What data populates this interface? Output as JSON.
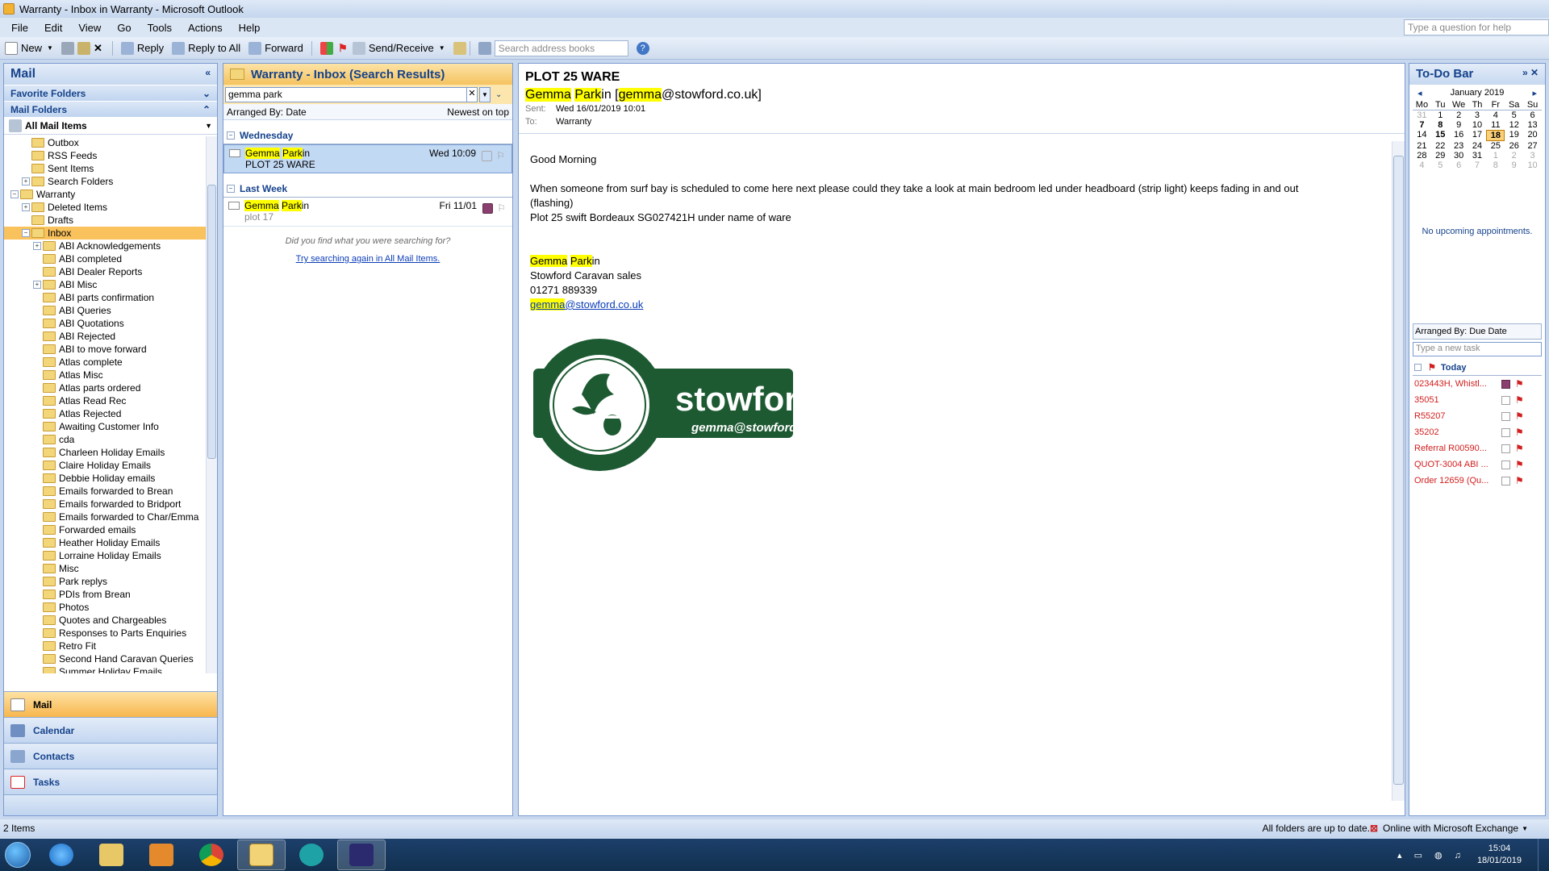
{
  "window": {
    "title": "Warranty - Inbox in Warranty - Microsoft Outlook"
  },
  "menu": {
    "items": [
      "File",
      "Edit",
      "View",
      "Go",
      "Tools",
      "Actions",
      "Help"
    ],
    "help_placeholder": "Type a question for help"
  },
  "toolbar": {
    "new_label": "New",
    "reply_label": "Reply",
    "reply_all_label": "Reply to All",
    "forward_label": "Forward",
    "send_receive_label": "Send/Receive",
    "address_placeholder": "Search address books"
  },
  "nav": {
    "title": "Mail",
    "favorite_folders": "Favorite Folders",
    "mail_folders": "Mail Folders",
    "all_mail_items": "All Mail Items",
    "folders": [
      {
        "label": "Outbox",
        "level": 2,
        "exp": ""
      },
      {
        "label": "RSS Feeds",
        "level": 2,
        "exp": ""
      },
      {
        "label": "Sent Items",
        "level": 2,
        "exp": ""
      },
      {
        "label": "Search Folders",
        "level": 2,
        "exp": "+"
      },
      {
        "label": "Warranty",
        "level": 1,
        "exp": "-"
      },
      {
        "label": "Deleted Items",
        "level": 2,
        "exp": "+"
      },
      {
        "label": "Drafts",
        "level": 2,
        "exp": ""
      },
      {
        "label": "Inbox",
        "level": 2,
        "exp": "-",
        "selected": true
      },
      {
        "label": "ABI Acknowledgements",
        "level": 3,
        "exp": "+"
      },
      {
        "label": "ABI completed",
        "level": 3,
        "exp": ""
      },
      {
        "label": "ABI Dealer Reports",
        "level": 3,
        "exp": ""
      },
      {
        "label": "ABI Misc",
        "level": 3,
        "exp": "+"
      },
      {
        "label": "ABI parts confirmation",
        "level": 3,
        "exp": ""
      },
      {
        "label": "ABI Queries",
        "level": 3,
        "exp": ""
      },
      {
        "label": "ABI Quotations",
        "level": 3,
        "exp": ""
      },
      {
        "label": "ABI Rejected",
        "level": 3,
        "exp": ""
      },
      {
        "label": "ABI to move forward",
        "level": 3,
        "exp": ""
      },
      {
        "label": "Atlas complete",
        "level": 3,
        "exp": ""
      },
      {
        "label": "Atlas Misc",
        "level": 3,
        "exp": ""
      },
      {
        "label": "Atlas parts ordered",
        "level": 3,
        "exp": ""
      },
      {
        "label": "Atlas Read Rec",
        "level": 3,
        "exp": ""
      },
      {
        "label": "Atlas Rejected",
        "level": 3,
        "exp": ""
      },
      {
        "label": "Awaiting Customer Info",
        "level": 3,
        "exp": ""
      },
      {
        "label": "cda",
        "level": 3,
        "exp": ""
      },
      {
        "label": "Charleen Holiday Emails",
        "level": 3,
        "exp": ""
      },
      {
        "label": "Claire Holiday Emails",
        "level": 3,
        "exp": ""
      },
      {
        "label": "Debbie Holiday emails",
        "level": 3,
        "exp": ""
      },
      {
        "label": "Emails forwarded to Brean",
        "level": 3,
        "exp": ""
      },
      {
        "label": "Emails forwarded to Bridport",
        "level": 3,
        "exp": ""
      },
      {
        "label": "Emails forwarded to Char/Emma",
        "level": 3,
        "exp": ""
      },
      {
        "label": "Forwarded emails",
        "level": 3,
        "exp": ""
      },
      {
        "label": "Heather Holiday Emails",
        "level": 3,
        "exp": ""
      },
      {
        "label": "Lorraine Holiday Emails",
        "level": 3,
        "exp": ""
      },
      {
        "label": "Misc",
        "level": 3,
        "exp": ""
      },
      {
        "label": "Park replys",
        "level": 3,
        "exp": ""
      },
      {
        "label": "PDIs from Brean",
        "level": 3,
        "exp": ""
      },
      {
        "label": "Photos",
        "level": 3,
        "exp": ""
      },
      {
        "label": "Quotes and Chargeables",
        "level": 3,
        "exp": ""
      },
      {
        "label": "Responses to Parts Enquiries",
        "level": 3,
        "exp": ""
      },
      {
        "label": "Retro Fit",
        "level": 3,
        "exp": ""
      },
      {
        "label": "Second Hand Caravan Queries",
        "level": 3,
        "exp": ""
      },
      {
        "label": "Summer Holiday Emails",
        "level": 3,
        "exp": ""
      }
    ],
    "buttons": [
      "Mail",
      "Calendar",
      "Contacts",
      "Tasks"
    ]
  },
  "list": {
    "title": "Warranty - Inbox (Search Results)",
    "search_value": "gemma park",
    "arranged_by": "Arranged By: Date",
    "sort_order": "Newest on top",
    "groups": [
      {
        "label": "Wednesday",
        "messages": [
          {
            "sender_hl": "Gemma",
            "sender_hl2": "Park",
            "sender_rest": "in",
            "subject": "PLOT 25 WARE",
            "date": "Wed 10:09",
            "selected": true
          }
        ]
      },
      {
        "label": "Last Week",
        "messages": [
          {
            "sender_hl": "Gemma",
            "sender_hl2": "Park",
            "sender_rest": "in",
            "subject": "plot 17",
            "date": "Fri 11/01",
            "selected": false
          }
        ]
      }
    ],
    "did_you_find": "Did you find what you were searching for?",
    "try_again": "Try searching again in All Mail Items."
  },
  "reading": {
    "subject": "PLOT 25 WARE",
    "from_first": "Gemma",
    "from_last_hl": "Park",
    "from_last_rest": "in",
    "from_open": "[",
    "from_email_hl": "gemma",
    "from_email_rest": "@stowford.co.uk]",
    "sent_label": "Sent:",
    "sent_value": "Wed 16/01/2019 10:01",
    "to_label": "To:",
    "to_value": "Warranty",
    "greeting": "Good Morning",
    "body_line1": "When someone from surf bay is scheduled to come here next please could they take a look at main bedroom led under headboard (strip light) keeps fading in and out",
    "body_line2": "(flashing)",
    "body_line3": "Plot 25 swift Bordeaux SG027421H under name of ware",
    "sig_first": "Gemma",
    "sig_last_hl": "Park",
    "sig_last_rest": "in",
    "sig_company": "Stowford Caravan sales",
    "sig_phone": "01271 889339",
    "sig_email_hl": "gemma",
    "sig_email_rest": "@stowford.co.uk",
    "logo_brand": "stowford",
    "logo_email": "gemma@stowford.co.uk"
  },
  "todo": {
    "title": "To-Do Bar",
    "month": "January 2019",
    "dow": [
      "Mo",
      "Tu",
      "We",
      "Th",
      "Fr",
      "Sa",
      "Su"
    ],
    "weeks": [
      [
        "31",
        "1",
        "2",
        "3",
        "4",
        "5",
        "6"
      ],
      [
        "7",
        "8",
        "9",
        "10",
        "11",
        "12",
        "13"
      ],
      [
        "14",
        "15",
        "16",
        "17",
        "18",
        "19",
        "20"
      ],
      [
        "21",
        "22",
        "23",
        "24",
        "25",
        "26",
        "27"
      ],
      [
        "28",
        "29",
        "30",
        "31",
        "1",
        "2",
        "3"
      ],
      [
        "4",
        "5",
        "6",
        "7",
        "8",
        "9",
        "10"
      ]
    ],
    "today": "18",
    "no_appointments": "No upcoming appointments.",
    "task_arranged": "Arranged By: Due Date",
    "task_placeholder": "Type a new task",
    "task_group": "Today",
    "tasks": [
      "023443H, Whistl...",
      "35051",
      "R55207",
      "35202",
      "Referral R00590...",
      "QUOT-3004 ABI ...",
      "Order 12659 (Qu..."
    ]
  },
  "status": {
    "items_count": "2 Items",
    "sync_status": "All folders are up to date.",
    "connection": "Online with Microsoft Exchange"
  },
  "taskbar": {
    "time": "15:04",
    "date": "18/01/2019"
  },
  "colors": {
    "accent_orange": "#f5c35f",
    "nav_blue": "#15428b",
    "highlight_yellow": "#ffff00",
    "stowford_green": "#1d5a32",
    "task_red": "#d21e1e"
  }
}
